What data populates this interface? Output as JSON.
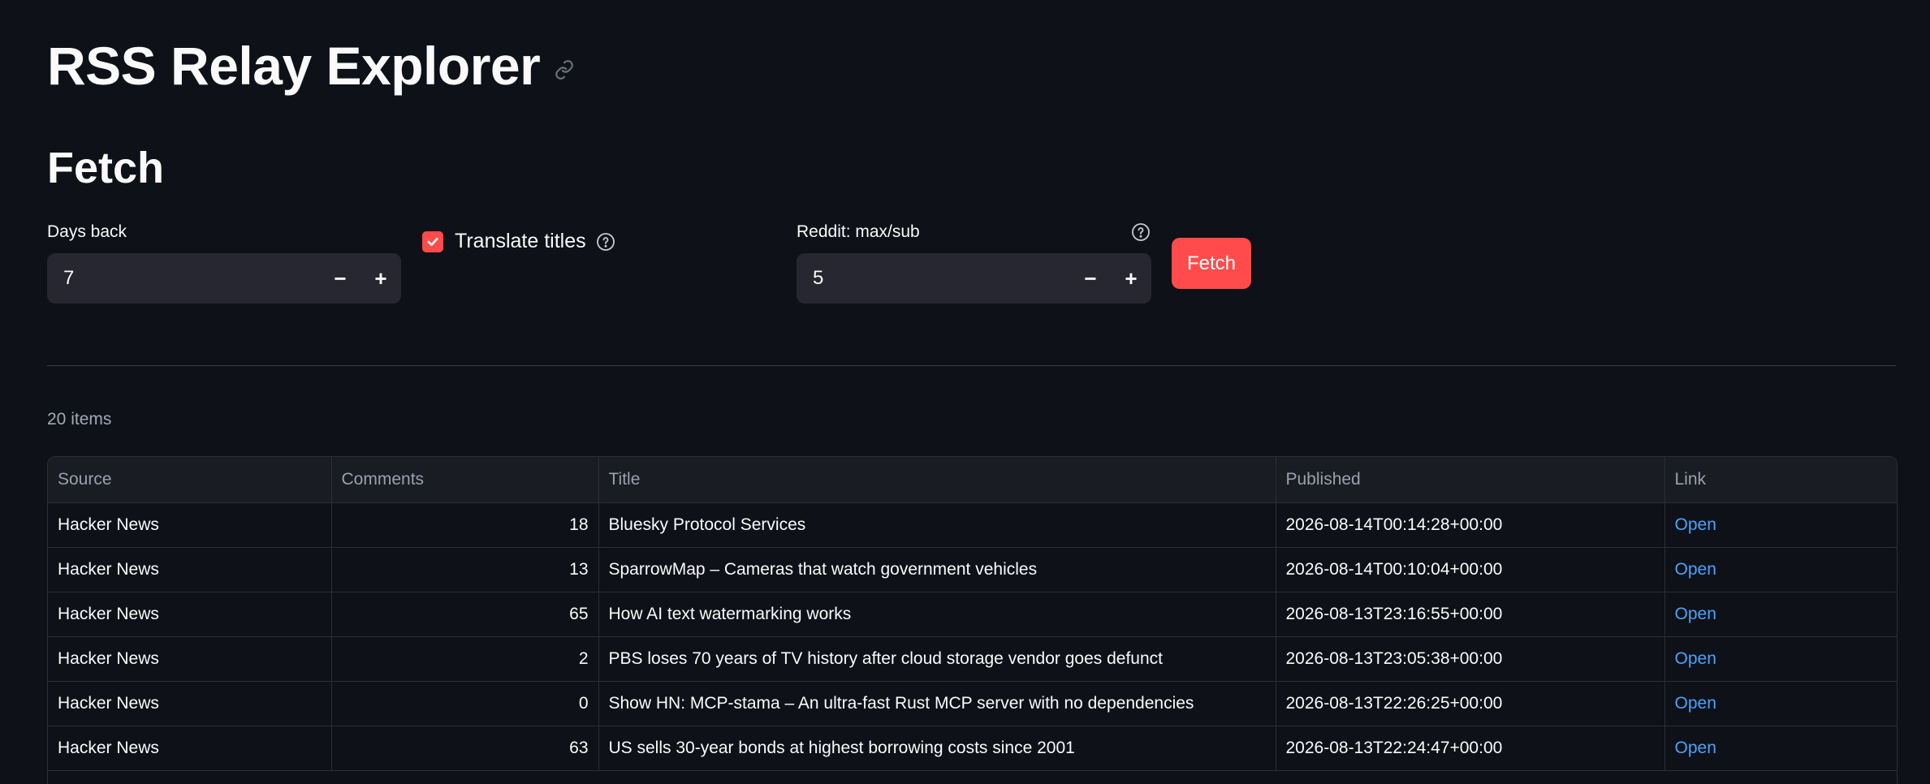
{
  "app": {
    "title": "RSS Relay Explorer"
  },
  "fetch_section": {
    "heading": "Fetch",
    "days_back": {
      "label": "Days back",
      "value": "7"
    },
    "translate": {
      "label": "Translate titles",
      "checked": true
    },
    "reddit_max": {
      "label": "Reddit: max/sub",
      "value": "5"
    },
    "fetch_button": "Fetch"
  },
  "results": {
    "count_label": "20 items",
    "columns": [
      "Source",
      "Comments",
      "Title",
      "Published",
      "Link"
    ],
    "rows": [
      {
        "source": "Hacker News",
        "comments": "18",
        "title": "Bluesky Protocol Services",
        "published": "2026-08-14T00:14:28+00:00",
        "link": "Open"
      },
      {
        "source": "Hacker News",
        "comments": "13",
        "title": "SparrowMap – Cameras that watch government vehicles",
        "published": "2026-08-14T00:10:04+00:00",
        "link": "Open"
      },
      {
        "source": "Hacker News",
        "comments": "65",
        "title": "How AI text watermarking works",
        "published": "2026-08-13T23:16:55+00:00",
        "link": "Open"
      },
      {
        "source": "Hacker News",
        "comments": "2",
        "title": "PBS loses 70 years of TV history after cloud storage vendor goes defunct",
        "published": "2026-08-13T23:05:38+00:00",
        "link": "Open"
      },
      {
        "source": "Hacker News",
        "comments": "0",
        "title": "Show HN: MCP-stama – An ultra-fast Rust MCP server with no dependencies",
        "published": "2026-08-13T22:26:25+00:00",
        "link": "Open"
      },
      {
        "source": "Hacker News",
        "comments": "63",
        "title": "US sells 30-year bonds at highest borrowing costs since 2001",
        "published": "2026-08-13T22:24:47+00:00",
        "link": "Open"
      }
    ]
  },
  "colors": {
    "background": "#0e1117",
    "accent": "#ff4b4b",
    "link": "#4aa3ff"
  }
}
